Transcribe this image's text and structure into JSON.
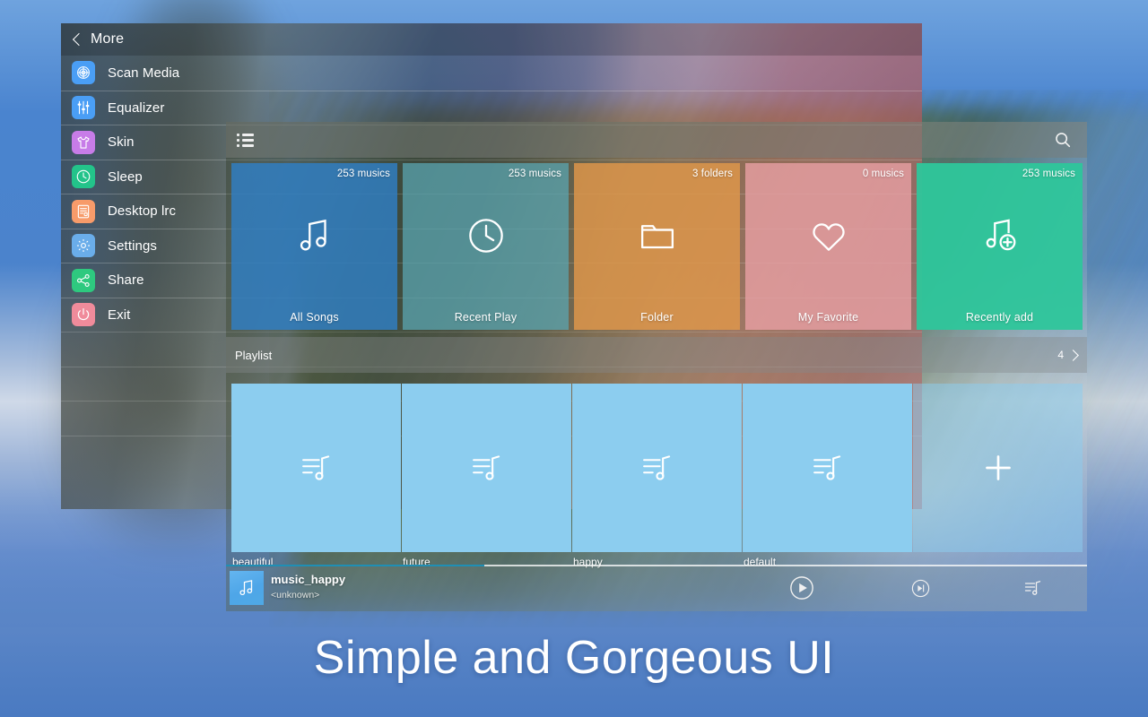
{
  "caption": "Simple and Gorgeous UI",
  "more_panel": {
    "title": "More",
    "back_icon": "chevron-left-icon",
    "items": [
      {
        "label": "Scan Media",
        "icon": "scan-media-icon",
        "color": "#4a9ef5"
      },
      {
        "label": "Equalizer",
        "icon": "equalizer-icon",
        "color": "#4a9ef5"
      },
      {
        "label": "Skin",
        "icon": "tshirt-icon",
        "color": "#c77ce8"
      },
      {
        "label": "Sleep",
        "icon": "clock-icon",
        "color": "#23c38a"
      },
      {
        "label": "Desktop lrc",
        "icon": "lyrics-doc-icon",
        "color": "#f79b6a"
      },
      {
        "label": "Settings",
        "icon": "gear-icon",
        "color": "#6aadea"
      },
      {
        "label": "Share",
        "icon": "share-icon",
        "color": "#2ec97f"
      },
      {
        "label": "Exit",
        "icon": "power-icon",
        "color": "#f08b9b"
      }
    ]
  },
  "music_panel": {
    "topbar": {
      "menu_icon": "list-menu-icon",
      "search_icon": "search-icon"
    },
    "categories": [
      {
        "label": "All Songs",
        "count": "253 musics",
        "icon": "music-note-icon",
        "color": "#2f7fc4"
      },
      {
        "label": "Recent Play",
        "count": "253 musics",
        "icon": "clock-icon",
        "color": "#5aa8b4"
      },
      {
        "label": "Folder",
        "count": "3 folders",
        "icon": "folder-icon",
        "color": "#e0974a"
      },
      {
        "label": "My Favorite",
        "count": "0 musics",
        "icon": "heart-icon",
        "color": "#e8a0a4"
      },
      {
        "label": "Recently add",
        "count": "253 musics",
        "icon": "music-add-icon",
        "color": "#2ec69b"
      }
    ],
    "playlist_header": {
      "title": "Playlist",
      "count": "4",
      "chevron_icon": "chevron-right-icon"
    },
    "playlists": [
      {
        "label": "beautiful",
        "icon": "playlist-note-icon"
      },
      {
        "label": "future",
        "icon": "playlist-note-icon"
      },
      {
        "label": "happy",
        "icon": "playlist-note-icon"
      },
      {
        "label": "default",
        "icon": "playlist-note-icon"
      },
      {
        "label": "",
        "icon": "plus-icon"
      }
    ],
    "now_playing": {
      "title": "music_happy",
      "artist": "<unknown>",
      "album_art_icon": "music-note-icon",
      "progress_percent": 30,
      "progress_color": "#1f8fb5",
      "play_icon": "play-icon",
      "next_icon": "next-track-icon",
      "queue_icon": "playlist-queue-icon"
    }
  }
}
